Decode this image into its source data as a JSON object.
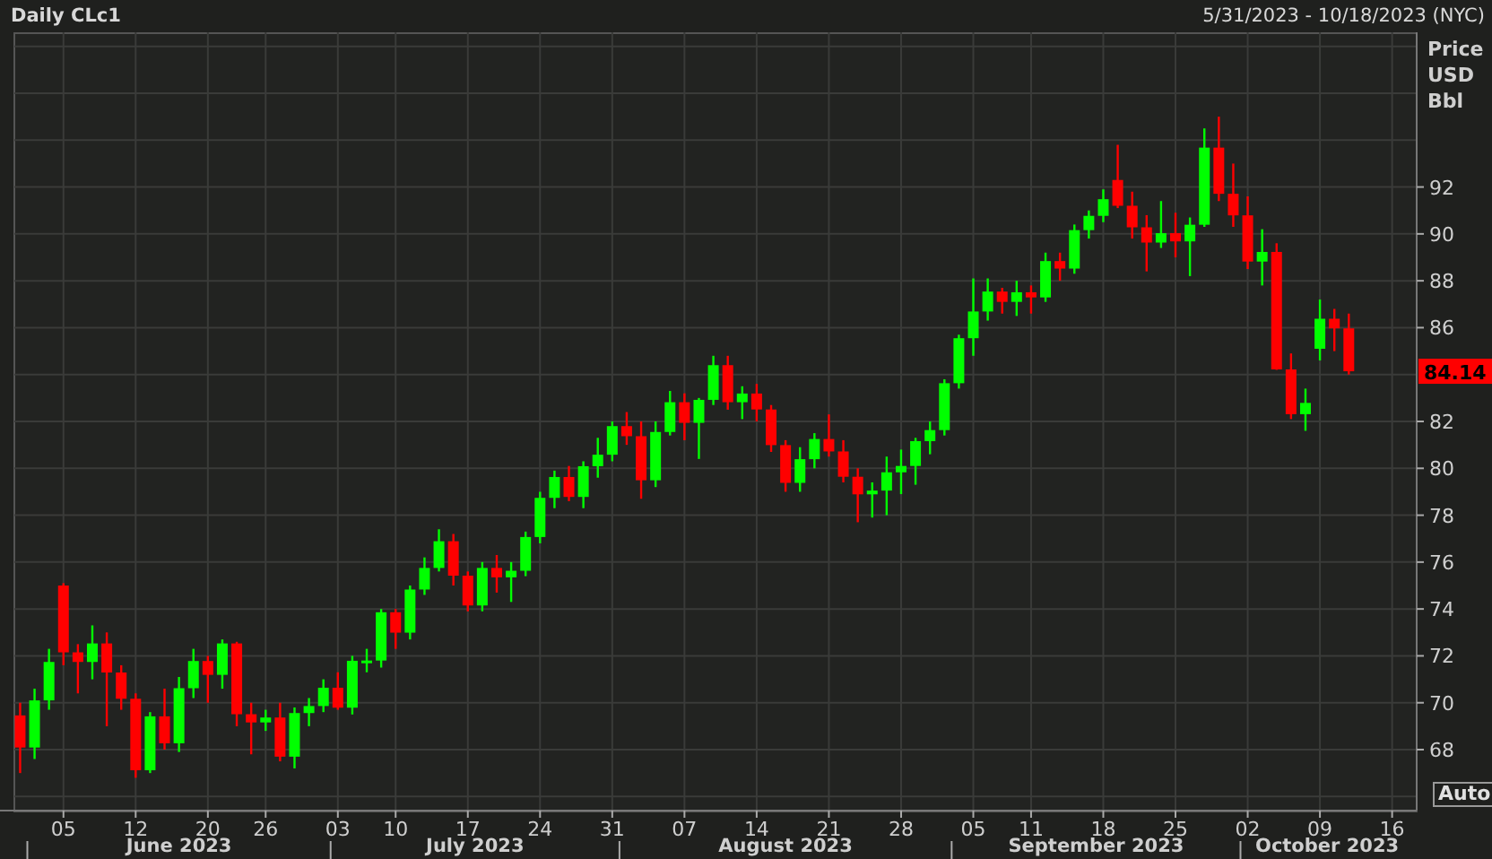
{
  "chart": {
    "title": "Daily CLc1",
    "date_range": "5/31/2023 - 10/18/2023 (NYC)",
    "axis_units": [
      "Price",
      "USD",
      "Bbl"
    ],
    "last_price": "84.14",
    "auto_button": "Auto",
    "months": [
      "June 2023",
      "July 2023",
      "August 2023",
      "September 2023",
      "October 2023"
    ],
    "chart_data": {
      "type": "candlestick",
      "grid": true,
      "ylim": [
        65.4,
        98.6
      ],
      "yticks": [
        68,
        70,
        72,
        74,
        76,
        78,
        80,
        82,
        86,
        88,
        90,
        92
      ],
      "categories": [
        null,
        null,
        null,
        "05",
        null,
        null,
        null,
        null,
        "12",
        null,
        null,
        null,
        null,
        "20",
        null,
        null,
        null,
        "26",
        null,
        null,
        null,
        null,
        "03",
        null,
        null,
        null,
        "10",
        null,
        null,
        null,
        null,
        "17",
        null,
        null,
        null,
        null,
        "24",
        null,
        null,
        null,
        null,
        "31",
        null,
        null,
        null,
        null,
        "07",
        null,
        null,
        null,
        null,
        "14",
        null,
        null,
        null,
        null,
        "21",
        null,
        null,
        null,
        null,
        "28",
        null,
        null,
        null,
        null,
        "05",
        null,
        null,
        null,
        "11",
        null,
        null,
        null,
        null,
        "18",
        null,
        null,
        null,
        null,
        "25",
        null,
        null,
        null,
        null,
        "02",
        null,
        null,
        null,
        null,
        "09",
        null,
        null,
        null,
        null,
        "16",
        null
      ],
      "ohlc": [
        [
          69.46,
          70.0,
          67.0,
          68.09
        ],
        [
          68.09,
          70.6,
          67.6,
          70.1
        ],
        [
          70.1,
          72.3,
          69.7,
          71.74
        ],
        [
          75.0,
          75.1,
          71.6,
          72.15
        ],
        [
          72.15,
          72.5,
          70.4,
          71.74
        ],
        [
          71.74,
          73.3,
          71.0,
          72.53
        ],
        [
          72.53,
          73.0,
          69.0,
          71.29
        ],
        [
          71.29,
          71.6,
          69.7,
          70.17
        ],
        [
          70.17,
          70.4,
          66.8,
          67.12
        ],
        [
          67.12,
          69.6,
          67.0,
          69.42
        ],
        [
          69.42,
          70.6,
          68.0,
          68.27
        ],
        [
          68.27,
          71.1,
          67.9,
          70.62
        ],
        [
          70.62,
          72.3,
          70.2,
          71.78
        ],
        [
          71.78,
          72.0,
          70.0,
          71.19
        ],
        [
          71.19,
          72.7,
          70.6,
          72.53
        ],
        [
          72.53,
          72.6,
          69.0,
          69.51
        ],
        [
          69.51,
          70.0,
          67.8,
          69.16
        ],
        [
          69.16,
          69.7,
          68.8,
          69.37
        ],
        [
          69.37,
          70.0,
          67.5,
          67.7
        ],
        [
          67.7,
          69.8,
          67.2,
          69.56
        ],
        [
          69.56,
          70.2,
          69.0,
          69.86
        ],
        [
          69.86,
          71.0,
          69.6,
          70.64
        ],
        [
          70.64,
          71.3,
          69.7,
          69.79
        ],
        [
          69.79,
          72.0,
          69.5,
          71.79
        ],
        [
          71.79,
          72.3,
          71.3,
          71.8
        ],
        [
          71.8,
          74.0,
          71.5,
          73.86
        ],
        [
          73.86,
          74.0,
          72.3,
          72.99
        ],
        [
          72.99,
          75.0,
          72.7,
          74.83
        ],
        [
          74.83,
          76.2,
          74.6,
          75.75
        ],
        [
          75.75,
          77.4,
          75.6,
          76.89
        ],
        [
          76.89,
          77.2,
          75.0,
          75.42
        ],
        [
          75.42,
          75.6,
          73.9,
          74.15
        ],
        [
          74.15,
          76.0,
          73.9,
          75.75
        ],
        [
          75.75,
          76.3,
          74.7,
          75.35
        ],
        [
          75.35,
          76.0,
          74.3,
          75.63
        ],
        [
          75.63,
          77.3,
          75.4,
          77.07
        ],
        [
          77.07,
          79.0,
          76.8,
          78.74
        ],
        [
          78.74,
          79.9,
          78.3,
          79.63
        ],
        [
          79.63,
          80.1,
          78.6,
          78.78
        ],
        [
          78.78,
          80.3,
          78.3,
          80.09
        ],
        [
          80.09,
          81.3,
          79.6,
          80.58
        ],
        [
          80.58,
          82.0,
          80.3,
          81.8
        ],
        [
          81.8,
          82.4,
          81.0,
          81.37
        ],
        [
          81.37,
          82.0,
          78.7,
          79.49
        ],
        [
          79.49,
          82.0,
          79.2,
          81.55
        ],
        [
          81.55,
          83.3,
          81.4,
          82.82
        ],
        [
          82.82,
          83.2,
          81.2,
          81.94
        ],
        [
          81.94,
          83.0,
          80.4,
          82.92
        ],
        [
          82.92,
          84.8,
          82.7,
          84.4
        ],
        [
          84.4,
          84.8,
          82.5,
          82.82
        ],
        [
          82.82,
          83.5,
          82.1,
          83.19
        ],
        [
          83.19,
          83.6,
          82.0,
          82.51
        ],
        [
          82.51,
          82.7,
          80.7,
          80.99
        ],
        [
          80.99,
          81.2,
          79.0,
          79.38
        ],
        [
          79.38,
          80.9,
          79.0,
          80.39
        ],
        [
          80.39,
          81.5,
          80.0,
          81.25
        ],
        [
          81.25,
          82.3,
          80.5,
          80.72
        ],
        [
          80.72,
          81.2,
          79.4,
          79.64
        ],
        [
          79.64,
          80.0,
          77.7,
          78.89
        ],
        [
          78.89,
          79.4,
          77.9,
          79.05
        ],
        [
          79.05,
          80.5,
          78.0,
          79.83
        ],
        [
          79.83,
          80.8,
          78.9,
          80.1
        ],
        [
          80.1,
          81.3,
          79.3,
          81.16
        ],
        [
          81.16,
          82.0,
          80.6,
          81.63
        ],
        [
          81.63,
          83.8,
          81.4,
          83.63
        ],
        [
          83.63,
          85.7,
          83.4,
          85.55
        ],
        [
          85.55,
          88.1,
          84.8,
          86.69
        ],
        [
          86.69,
          88.1,
          86.3,
          87.54
        ],
        [
          87.54,
          87.7,
          86.6,
          87.1
        ],
        [
          87.1,
          88.0,
          86.5,
          87.51
        ],
        [
          87.51,
          87.8,
          86.6,
          87.29
        ],
        [
          87.29,
          89.2,
          87.1,
          88.84
        ],
        [
          88.84,
          89.2,
          88.0,
          88.52
        ],
        [
          88.52,
          90.4,
          88.3,
          90.16
        ],
        [
          90.16,
          91.0,
          89.8,
          90.77
        ],
        [
          90.77,
          91.9,
          90.5,
          91.48
        ],
        [
          92.3,
          93.8,
          91.1,
          91.2
        ],
        [
          91.2,
          91.8,
          89.8,
          90.28
        ],
        [
          90.28,
          90.8,
          88.4,
          89.63
        ],
        [
          89.63,
          91.4,
          89.4,
          90.03
        ],
        [
          90.03,
          90.9,
          89.0,
          89.68
        ],
        [
          89.68,
          90.7,
          88.2,
          90.39
        ],
        [
          90.39,
          94.5,
          90.3,
          93.68
        ],
        [
          93.68,
          95.0,
          91.4,
          91.71
        ],
        [
          91.71,
          93.0,
          90.3,
          90.79
        ],
        [
          90.79,
          91.6,
          88.5,
          88.82
        ],
        [
          88.82,
          90.2,
          87.8,
          89.23
        ],
        [
          89.23,
          89.6,
          84.2,
          84.22
        ],
        [
          84.22,
          84.9,
          82.1,
          82.31
        ],
        [
          82.31,
          83.4,
          81.6,
          82.79
        ],
        [
          85.1,
          87.2,
          84.6,
          86.38
        ],
        [
          86.38,
          86.8,
          85.0,
          85.97
        ],
        [
          85.97,
          86.6,
          84.0,
          84.14
        ],
        null,
        null,
        null,
        null
      ]
    }
  }
}
